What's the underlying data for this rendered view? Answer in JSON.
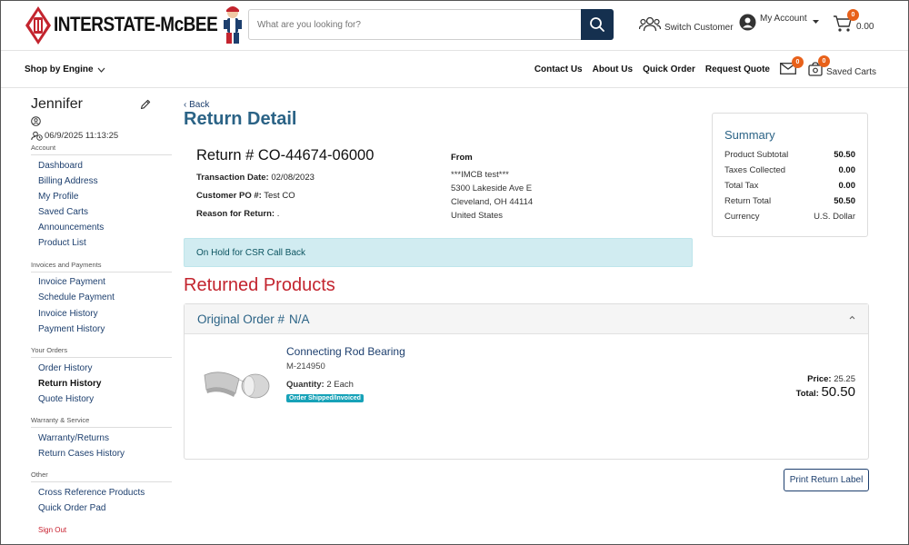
{
  "brand": {
    "logo_text": "INTERSTATE-McBEE",
    "accent_color": "#c3242e",
    "navy_color": "#15304f",
    "badge_color": "#e8611a"
  },
  "header": {
    "search_placeholder": "What are you looking for?",
    "switch_customer": "Switch Customer",
    "my_account": "My Account",
    "cart_count": "0",
    "cart_total": "0.00"
  },
  "nav": {
    "shop_by_engine": "Shop by Engine",
    "links": [
      "Contact Us",
      "About Us",
      "Quick Order",
      "Request Quote"
    ],
    "messages_count": "0",
    "saved_carts_count": "0",
    "saved_carts": "Saved Carts"
  },
  "sidebar": {
    "user_name": "Jennifer",
    "last_login": "06/9/2025 11:13:25",
    "groups": [
      {
        "heading": "Account",
        "items": [
          "Dashboard",
          "Billing Address",
          "My Profile",
          "Saved Carts",
          "Announcements",
          "Product List"
        ]
      },
      {
        "heading": "Invoices and Payments",
        "items": [
          "Invoice Payment",
          "Schedule Payment",
          "Invoice History",
          "Payment History"
        ]
      },
      {
        "heading": "Your Orders",
        "items": [
          "Order History",
          "Return History",
          "Quote History"
        ]
      },
      {
        "heading": "Warranty & Service",
        "items": [
          "Warranty/Returns",
          "Return Cases History"
        ]
      },
      {
        "heading": "Other",
        "items": [
          "Cross Reference Products",
          "Quick Order Pad"
        ]
      }
    ],
    "sign_out": "Sign Out"
  },
  "main": {
    "back": "Back",
    "title": "Return Detail",
    "return_label": "Return #",
    "return_number": "CO-44674-06000",
    "transaction_date_label": "Transaction Date:",
    "transaction_date": "02/08/2023",
    "customer_po_label": "Customer PO #:",
    "customer_po": "Test CO",
    "reason_label": "Reason for Return:",
    "reason": ".",
    "from_label": "From",
    "from_lines": [
      "***IMCB test***",
      "5300 Lakeside Ave E",
      "Cleveland, OH 44114",
      "United States"
    ],
    "alert": "On Hold for CSR Call Back",
    "returned_products_title": "Returned Products"
  },
  "summary": {
    "title": "Summary",
    "rows": [
      {
        "label": "Product Subtotal",
        "value": "50.50",
        "bold": true
      },
      {
        "label": "Taxes Collected",
        "value": "0.00",
        "bold": true
      },
      {
        "label": "Total Tax",
        "value": "0.00",
        "bold": true
      },
      {
        "label": "Return Total",
        "value": "50.50",
        "bold": true
      },
      {
        "label": "Currency",
        "value": "U.S. Dollar",
        "bold": false
      }
    ]
  },
  "order": {
    "header_label": "Original Order #",
    "header_value": "N/A",
    "product": {
      "name": "Connecting Rod Bearing",
      "sku": "M-214950",
      "quantity_label": "Quantity:",
      "quantity": "2 Each",
      "status": "Order Shipped/Invoiced",
      "price_label": "Price:",
      "price": "25.25",
      "total_label": "Total:",
      "total": "50.50"
    }
  },
  "actions": {
    "print_return_label": "Print Return Label"
  }
}
